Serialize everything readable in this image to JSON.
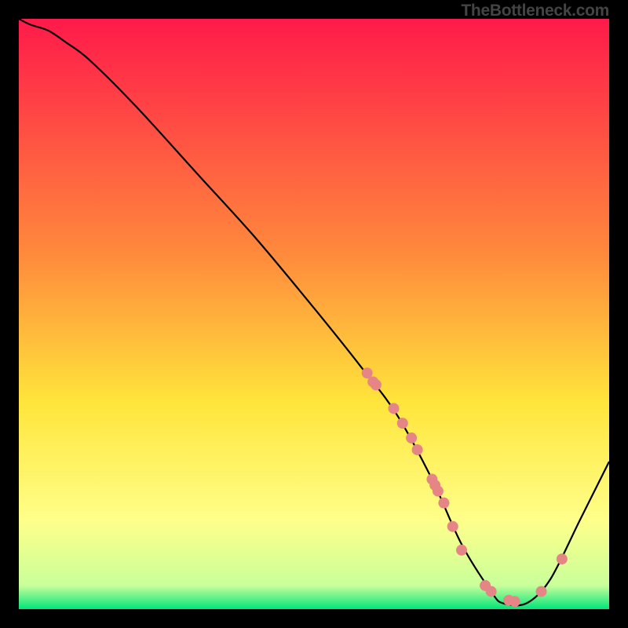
{
  "watermark": "TheBottleneck.com",
  "chart_data": {
    "type": "line",
    "title": "",
    "xlabel": "",
    "ylabel": "",
    "xlim": [
      0,
      100
    ],
    "ylim": [
      0,
      100
    ],
    "grid": false,
    "legend": false,
    "background_gradient": {
      "stops": [
        {
          "offset": 0.0,
          "color": "#FF1A4A"
        },
        {
          "offset": 0.4,
          "color": "#FF8A3C"
        },
        {
          "offset": 0.65,
          "color": "#FFE53B"
        },
        {
          "offset": 0.85,
          "color": "#FFFF8A"
        },
        {
          "offset": 0.96,
          "color": "#C9FF9A"
        },
        {
          "offset": 1.0,
          "color": "#00E57A"
        }
      ]
    },
    "series": [
      {
        "name": "bottleneck-curve",
        "color": "#000000",
        "x": [
          0,
          2,
          5,
          8,
          12,
          20,
          30,
          40,
          50,
          58,
          64,
          70,
          75,
          80,
          82,
          86,
          90,
          95,
          100
        ],
        "y": [
          100,
          99,
          98,
          96,
          93,
          85,
          74,
          63,
          51,
          41,
          33,
          22,
          11,
          3,
          1,
          1,
          5,
          15,
          25
        ]
      }
    ],
    "points": {
      "name": "highlighted-points",
      "color": "#E68585",
      "radius": 7,
      "data": [
        {
          "x": 59.0,
          "y": 40.0
        },
        {
          "x": 60.0,
          "y": 38.5
        },
        {
          "x": 60.5,
          "y": 38.0
        },
        {
          "x": 63.5,
          "y": 34.0
        },
        {
          "x": 65.0,
          "y": 31.5
        },
        {
          "x": 66.5,
          "y": 29.0
        },
        {
          "x": 67.5,
          "y": 27.0
        },
        {
          "x": 70.0,
          "y": 22.0
        },
        {
          "x": 70.5,
          "y": 21.0
        },
        {
          "x": 71.0,
          "y": 20.0
        },
        {
          "x": 72.0,
          "y": 18.0
        },
        {
          "x": 73.5,
          "y": 14.0
        },
        {
          "x": 75.0,
          "y": 10.0
        },
        {
          "x": 79.0,
          "y": 4.0
        },
        {
          "x": 80.0,
          "y": 3.0
        },
        {
          "x": 83.0,
          "y": 1.5
        },
        {
          "x": 84.0,
          "y": 1.3
        },
        {
          "x": 88.5,
          "y": 3.0
        },
        {
          "x": 92.0,
          "y": 8.5
        }
      ]
    }
  }
}
